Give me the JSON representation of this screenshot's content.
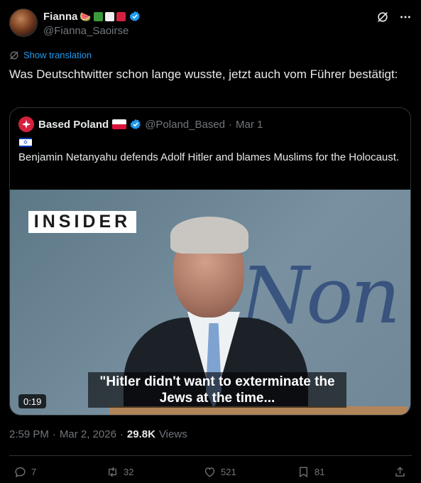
{
  "author": {
    "display_name": "Fianna",
    "name_emoji": "🍉",
    "flag_colors": [
      "#3a9a3a",
      "#f0f0f0",
      "#d4213d"
    ],
    "handle": "@Fianna_Saoirse",
    "verified_color": "#1d9bf0"
  },
  "translate": {
    "label": "Show translation"
  },
  "tweet_text": "Was Deutschtwitter schon lange wusste, jetzt auch vom Führer bestätigt:",
  "quote": {
    "display_name": "Based Poland",
    "handle": "@Poland_Based",
    "separator": "·",
    "date": "Mar 1",
    "text": "Benjamin Netanyahu defends Adolf Hitler and blames Muslims for the Holocaust.",
    "video": {
      "logo_text": "INSIDER",
      "background_text": "Non",
      "caption_line1": "\"Hitler didn't want to exterminate the",
      "caption_line2": "Jews at the time...",
      "duration": "0:19"
    }
  },
  "meta": {
    "time": "2:59 PM",
    "separator1": "·",
    "date": "Mar 2, 2026",
    "separator2": "·",
    "views_count": "29.8K",
    "views_label": "Views"
  },
  "actions": {
    "replies": "7",
    "reposts": "32",
    "likes": "521",
    "bookmarks": "81"
  },
  "colors": {
    "accent": "#1d9bf0",
    "secondary_text": "#71767b",
    "background": "#000000"
  }
}
